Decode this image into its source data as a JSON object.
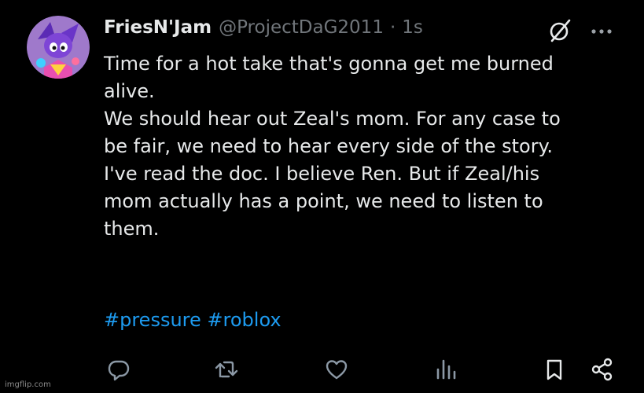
{
  "tweet": {
    "display_name": "FriesN'Jam",
    "handle": "@ProjectDaG2011",
    "separator": "·",
    "time": "1s",
    "text_lines": [
      "Time for a hot take that's gonna get me burned",
      "alive.",
      "We should hear out Zeal's mom. For any case to",
      "be fair, we need to hear every side of the story.",
      "I've read the doc. I believe Ren. But if Zeal/his",
      "mom actually has a point, we need to listen to",
      "them."
    ],
    "hashtags": [
      "#pressure",
      "#roblox"
    ]
  },
  "icons": {
    "grok": "grok-icon",
    "more": "more-icon",
    "reply": "reply-icon",
    "retweet": "retweet-icon",
    "like": "like-icon",
    "views": "views-icon",
    "bookmark": "bookmark-icon",
    "share": "share-icon"
  },
  "colors": {
    "background": "#000000",
    "text": "#e7e9ea",
    "secondary": "#71767b",
    "link": "#1d9bf0"
  },
  "watermark": "imgflip.com"
}
